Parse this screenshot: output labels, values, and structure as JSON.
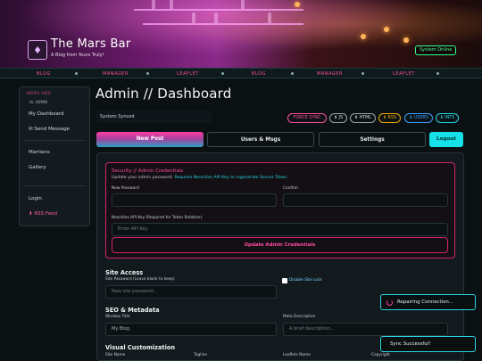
{
  "header": {
    "site_title": "The Mars Bar",
    "tagline": "A Blog from Yours Truly!",
    "status": "System Online"
  },
  "marquee": [
    {
      "label": "BLOG",
      "color": "#ff4da0"
    },
    {
      "label": "MANAGER",
      "color": "#ff4da0"
    },
    {
      "label": "LEAFLET",
      "color": "#ff4da0"
    },
    {
      "label": "BLOG",
      "color": "#ff4da0"
    },
    {
      "label": "MANAGER",
      "color": "#ff4da0"
    },
    {
      "label": "LEAFLET",
      "color": "#ff4da0"
    }
  ],
  "sidebar": {
    "heading": "MARS ADS",
    "user": "Hi, ADMIN",
    "items": [
      {
        "label": "My Dashboard"
      },
      {
        "label": "✉ Send Message"
      },
      {
        "label": "Martians"
      },
      {
        "label": "Gallery"
      },
      {
        "label": "Login"
      },
      {
        "label": "⬇ RSS Feed"
      }
    ]
  },
  "main": {
    "title": "Admin // Dashboard",
    "sync_status": "System Synced",
    "pills": [
      {
        "label": "FORCE SYNC",
        "color": "#ff4da0"
      },
      {
        "label": "⬇ JS",
        "color": "#d7dde2"
      },
      {
        "label": "⬇ HTML",
        "color": "#d7dde2"
      },
      {
        "label": "⬇ RSS",
        "color": "#f0a800"
      },
      {
        "label": "⬇ USERS",
        "color": "#3aa0ff"
      },
      {
        "label": "⬇ INTS",
        "color": "#22d6e0"
      }
    ],
    "tabs": {
      "new_post": "New Post",
      "users": "Users & Msgs",
      "settings": "Settings",
      "logout": "Logout"
    }
  },
  "security": {
    "title": "Security // Admin Credentials",
    "subtitle_a": "Update your admin password. ",
    "subtitle_b": "Requires Neocities API Key to regenerate Secure Token.",
    "new_password_label": "New Password",
    "confirm_label": "Confirm",
    "api_label": "Neocities API Key (Required for Token Rotation)",
    "api_placeholder": "Enter API Key",
    "update_button": "Update Admin Credentials"
  },
  "site_access": {
    "title": "Site Access",
    "password_label": "Site Password (Leave blank to keep)",
    "password_placeholder": "New site password...",
    "lock_label": "Disable Site Lock"
  },
  "seo": {
    "title": "SEO & Metadata",
    "window_title_label": "Window Title",
    "window_title_value": "My Blog",
    "meta_label": "Meta Description",
    "meta_placeholder": "A brief description..."
  },
  "visual": {
    "title": "Visual Customization",
    "labels": [
      "Site Name",
      "Tagline",
      "Leaflets Name",
      "Copyright"
    ]
  },
  "toasts": {
    "repairing": "Repairing Connection...",
    "sync": "Sync Successful!"
  }
}
